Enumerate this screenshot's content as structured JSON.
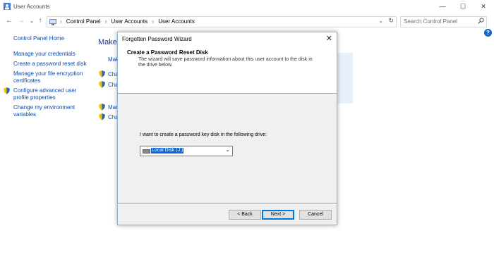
{
  "window": {
    "title": "User Accounts",
    "minimize": "—",
    "maximize": "☐",
    "close": "✕"
  },
  "nav": {
    "back": "←",
    "forward": "→",
    "recent": "⌄",
    "up": "↑"
  },
  "address": {
    "crumbs": [
      "Control Panel",
      "User Accounts",
      "User Accounts"
    ],
    "separator": "›",
    "dropdown": "⌄",
    "refresh": "↻"
  },
  "search": {
    "placeholder": "Search Control Panel",
    "icon": "search-icon"
  },
  "help": "?",
  "left_nav": {
    "home": "Control Panel Home",
    "items": [
      "Manage your credentials",
      "Create a password reset disk",
      "Manage your file encryption certificates",
      "Configure advanced user profile properties",
      "Change my environment variables"
    ]
  },
  "background": {
    "heading": "Make",
    "items": [
      "Make",
      "Cha",
      "Cha",
      "Mar",
      "Cha"
    ]
  },
  "dialog": {
    "title": "Forgotten Password Wizard",
    "close": "✕",
    "header_title": "Create a Password Reset Disk",
    "header_desc": "The wizard will save password information about this user account to the disk in the drive below.",
    "prompt": "I want to create a password key disk in the following drive:",
    "drive_value": "Local Disk (J:)",
    "drive_chevron": "⌄",
    "buttons": {
      "back": "< Back",
      "next": "Next >",
      "cancel": "Cancel"
    }
  },
  "colors": {
    "link": "#0d4aa8",
    "heading": "#1e3287",
    "selection": "#0a64d6",
    "dialog_bg": "#f0f0f0"
  }
}
